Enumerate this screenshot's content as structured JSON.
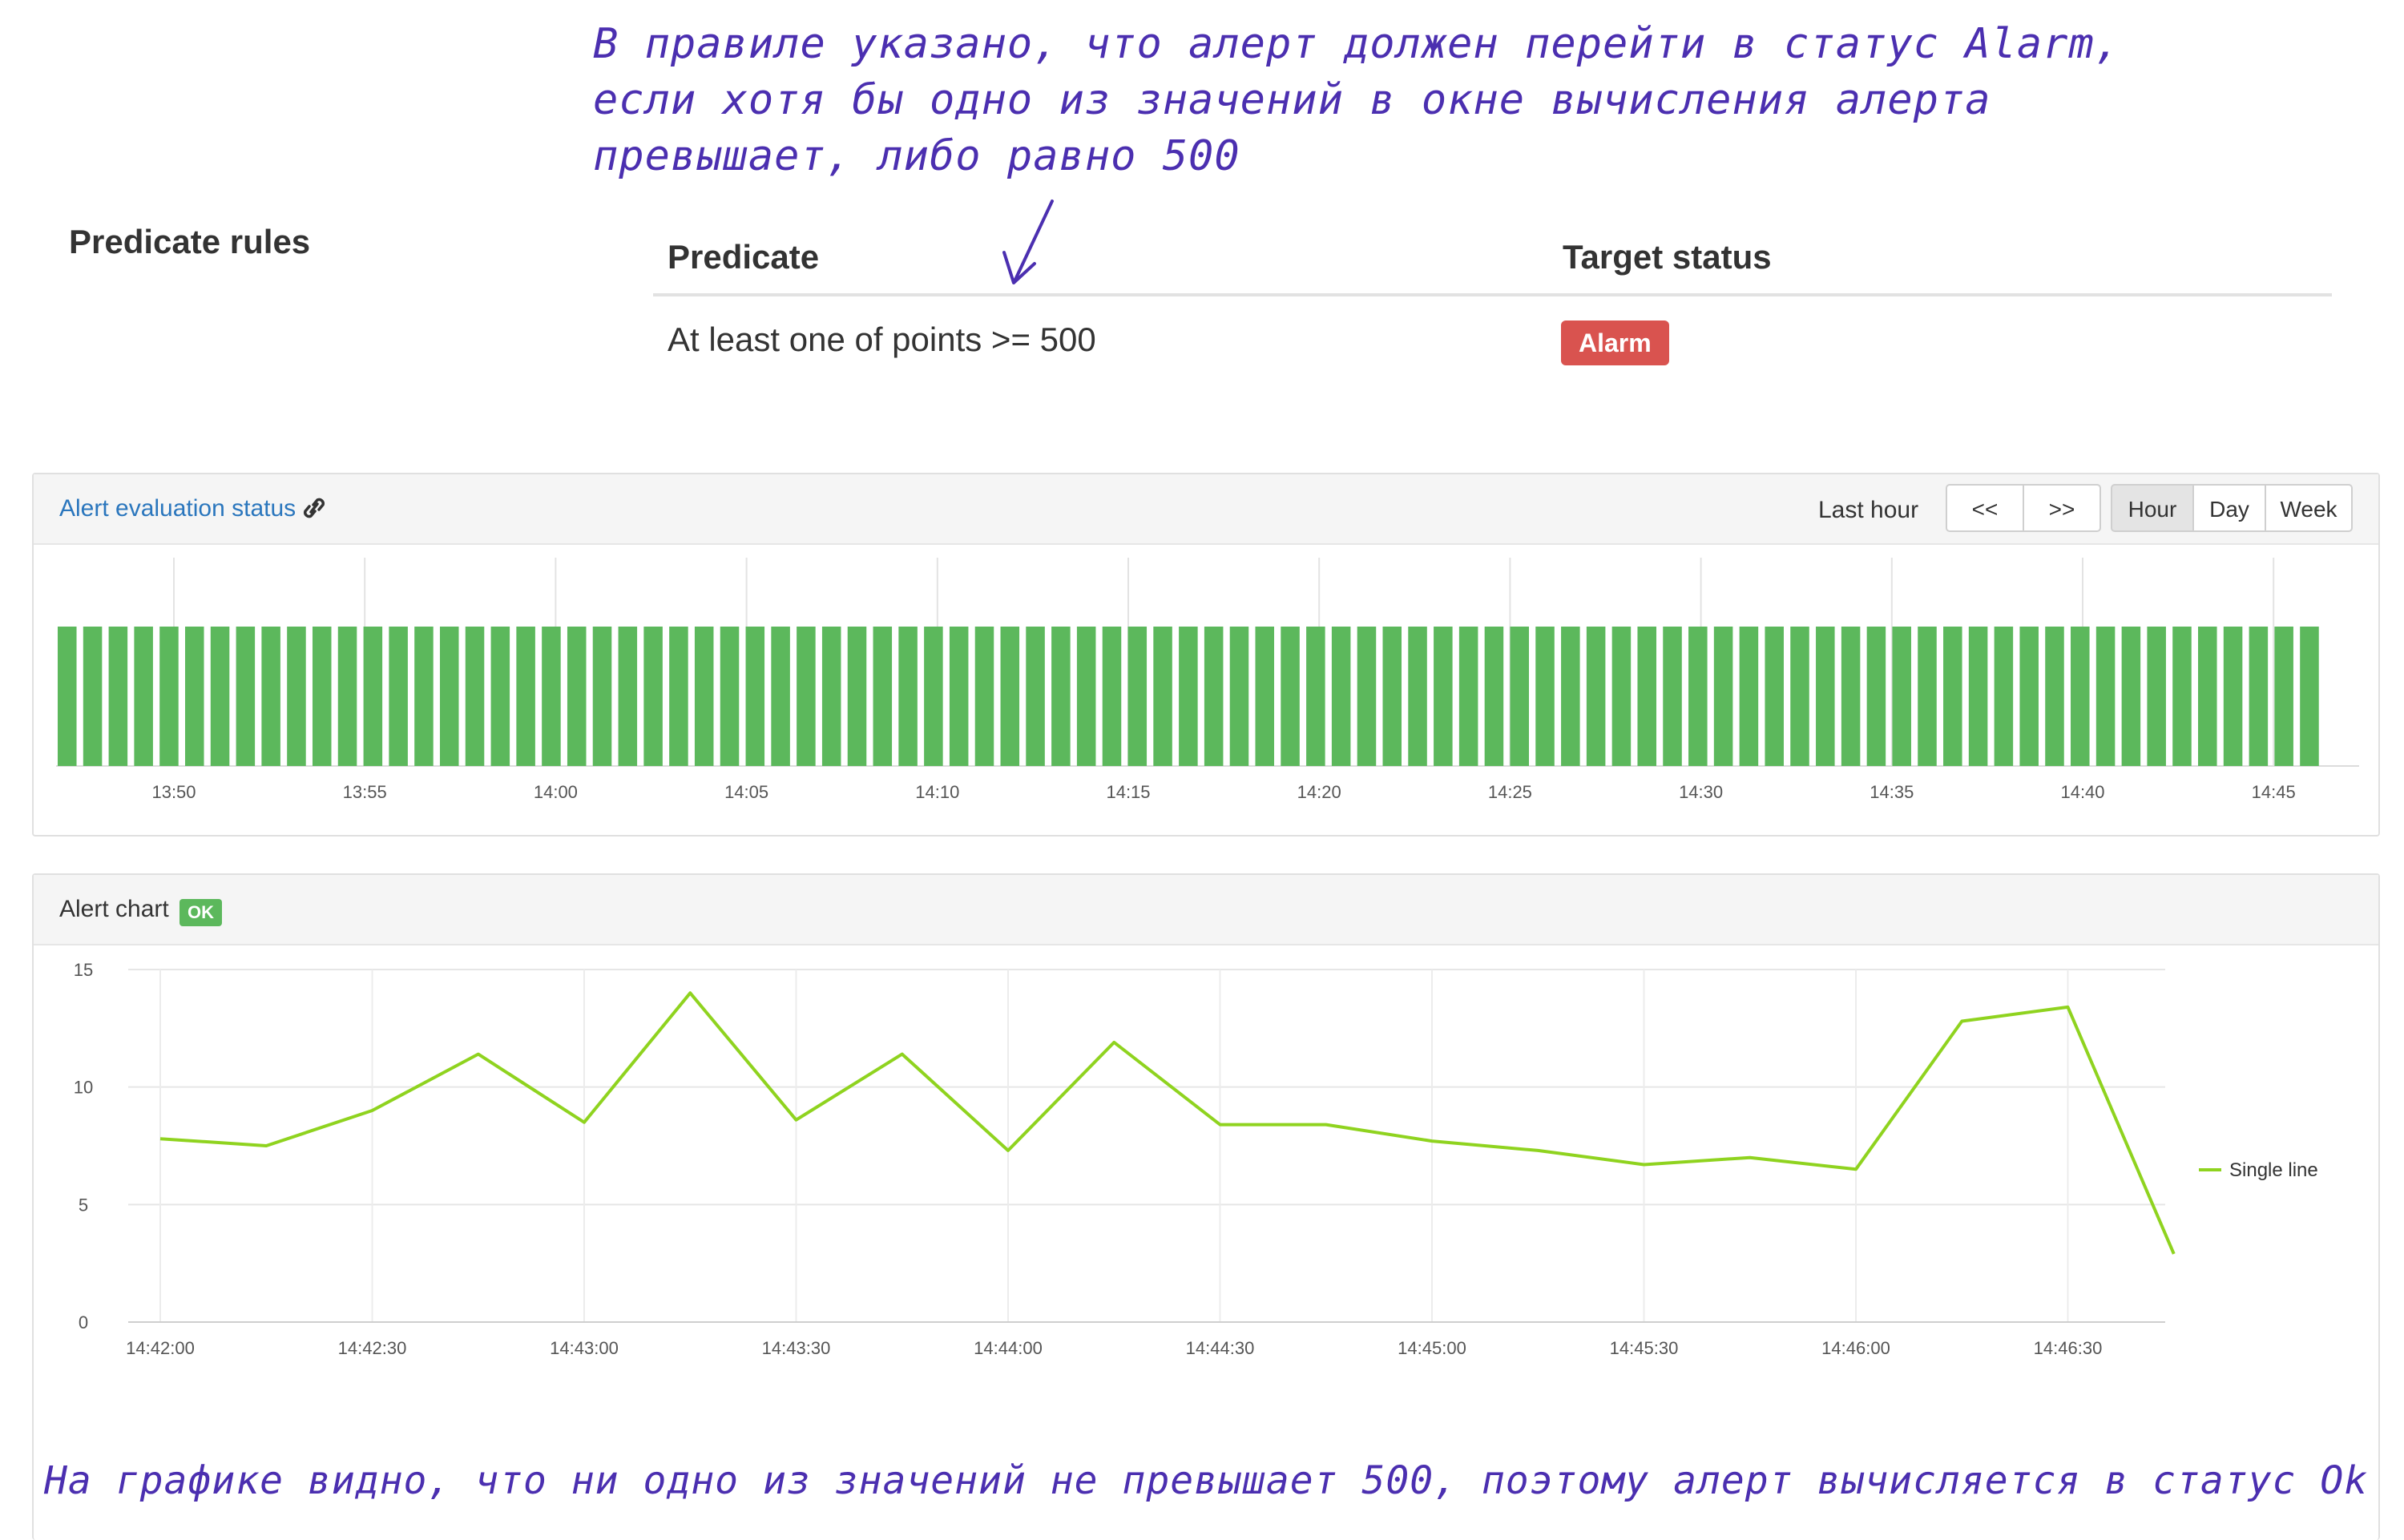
{
  "annotations": {
    "top_lines": [
      "В правиле указано, что алерт должен перейти в статус Alarm,",
      "если хотя бы одно из значений в окне вычисления алерта",
      "превышает, либо равно 500"
    ],
    "bottom": "На графике видно, что ни одно из значений не превышает 500, поэтому алерт вычисляется в статус Ok"
  },
  "predicate_rules": {
    "section_title": "Predicate rules",
    "columns": {
      "predicate": "Predicate",
      "target_status": "Target status"
    },
    "rows": [
      {
        "predicate": "At least one of points >= 500",
        "target_status": "Alarm"
      }
    ]
  },
  "evaluation_panel": {
    "title": "Alert evaluation status",
    "range_label": "Last hour",
    "nav": {
      "prev": "<<",
      "next": ">>"
    },
    "periods": [
      "Hour",
      "Day",
      "Week"
    ],
    "selected_period": "Hour",
    "tick_labels": [
      "13:50",
      "13:55",
      "14:00",
      "14:05",
      "14:10",
      "14:15",
      "14:20",
      "14:25",
      "14:30",
      "14:35",
      "14:40",
      "14:45"
    ],
    "bar_count": 89,
    "status_color": "#5cb85c"
  },
  "chart_panel": {
    "title": "Alert chart",
    "status_badge": "OK"
  },
  "chart_data": {
    "type": "line",
    "x": [
      "14:42:00",
      "14:42:15",
      "14:42:30",
      "14:42:45",
      "14:43:00",
      "14:43:15",
      "14:43:30",
      "14:43:45",
      "14:44:00",
      "14:44:15",
      "14:44:30",
      "14:44:45",
      "14:45:00",
      "14:45:15",
      "14:45:30",
      "14:45:45",
      "14:46:00",
      "14:46:15",
      "14:46:30",
      "14:46:45"
    ],
    "series": [
      {
        "name": "Single line",
        "color": "#8fd31f",
        "values": [
          7.8,
          7.5,
          9.0,
          11.4,
          8.5,
          14.0,
          8.6,
          11.4,
          7.3,
          11.9,
          8.4,
          8.4,
          7.7,
          7.3,
          6.7,
          7.0,
          6.5,
          12.8,
          13.4,
          2.9
        ]
      }
    ],
    "x_tick_labels": [
      "14:42:00",
      "14:42:30",
      "14:43:00",
      "14:43:30",
      "14:44:00",
      "14:44:30",
      "14:45:00",
      "14:45:30",
      "14:46:00",
      "14:46:30"
    ],
    "y_ticks": [
      0,
      5,
      10,
      15
    ],
    "ylim": [
      0,
      15
    ],
    "grid": true,
    "legend": "right"
  }
}
